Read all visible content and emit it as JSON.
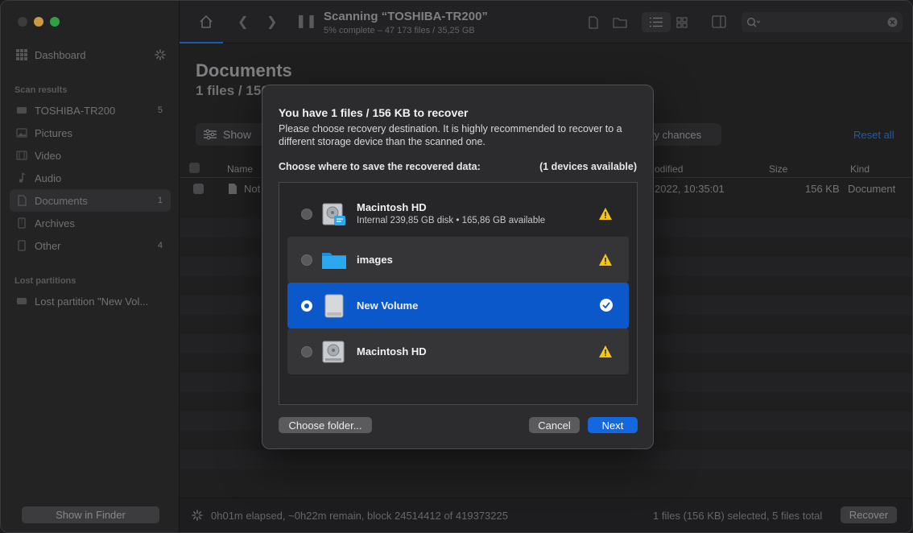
{
  "app": {
    "scan_title": "Scanning “TOSHIBA-TR200”",
    "scan_subtitle": "5% complete – 47 173 files / 35,25 GB"
  },
  "sidebar": {
    "dashboard": "Dashboard",
    "scan_results_heading": "Scan results",
    "items": [
      {
        "label": "TOSHIBA-TR200",
        "badge": "5"
      },
      {
        "label": "Pictures",
        "badge": ""
      },
      {
        "label": "Video",
        "badge": ""
      },
      {
        "label": "Audio",
        "badge": ""
      },
      {
        "label": "Documents",
        "badge": "1"
      },
      {
        "label": "Archives",
        "badge": ""
      },
      {
        "label": "Other",
        "badge": "4"
      }
    ],
    "lost_partitions_heading": "Lost partitions",
    "lost_partition": "Lost partition \"New Vol...",
    "show_in_finder": "Show in Finder"
  },
  "main": {
    "title": "Documents",
    "subtitle": "1 files / 156",
    "show_label": "Show",
    "chances_label": "ery chances",
    "reset_all": "Reset all",
    "columns": {
      "name": "Name",
      "modified": "odified",
      "size": "Size",
      "kind": "Kind"
    },
    "row": {
      "name": "Not",
      "modified": "2022, 10:35:01",
      "size": "156 KB",
      "kind": "Document"
    }
  },
  "status": {
    "elapsed": "0h01m elapsed, ~0h22m remain, block 24514412 of 419373225",
    "selected": "1 files (156 KB) selected, 5 files total",
    "recover": "Recover"
  },
  "dialog": {
    "title": "You have 1 files / 156 KB to recover",
    "description": "Please choose recovery destination. It is highly recommended to recover to a different storage device than the scanned one.",
    "choose_label": "Choose where to save the recovered data:",
    "available": "(1 devices available)",
    "devices": [
      {
        "name": "Macintosh HD",
        "info": "Internal 239,85 GB disk • 165,86 GB available"
      },
      {
        "name": "images",
        "info": ""
      },
      {
        "name": "New Volume",
        "info": ""
      },
      {
        "name": "Macintosh HD",
        "info": ""
      }
    ],
    "choose_folder": "Choose folder...",
    "cancel": "Cancel",
    "next": "Next"
  },
  "colors": {
    "accent": "#1368e0",
    "selected_row": "#0a58ca",
    "warning": "#f5c518",
    "folder": "#2aa8f0"
  }
}
